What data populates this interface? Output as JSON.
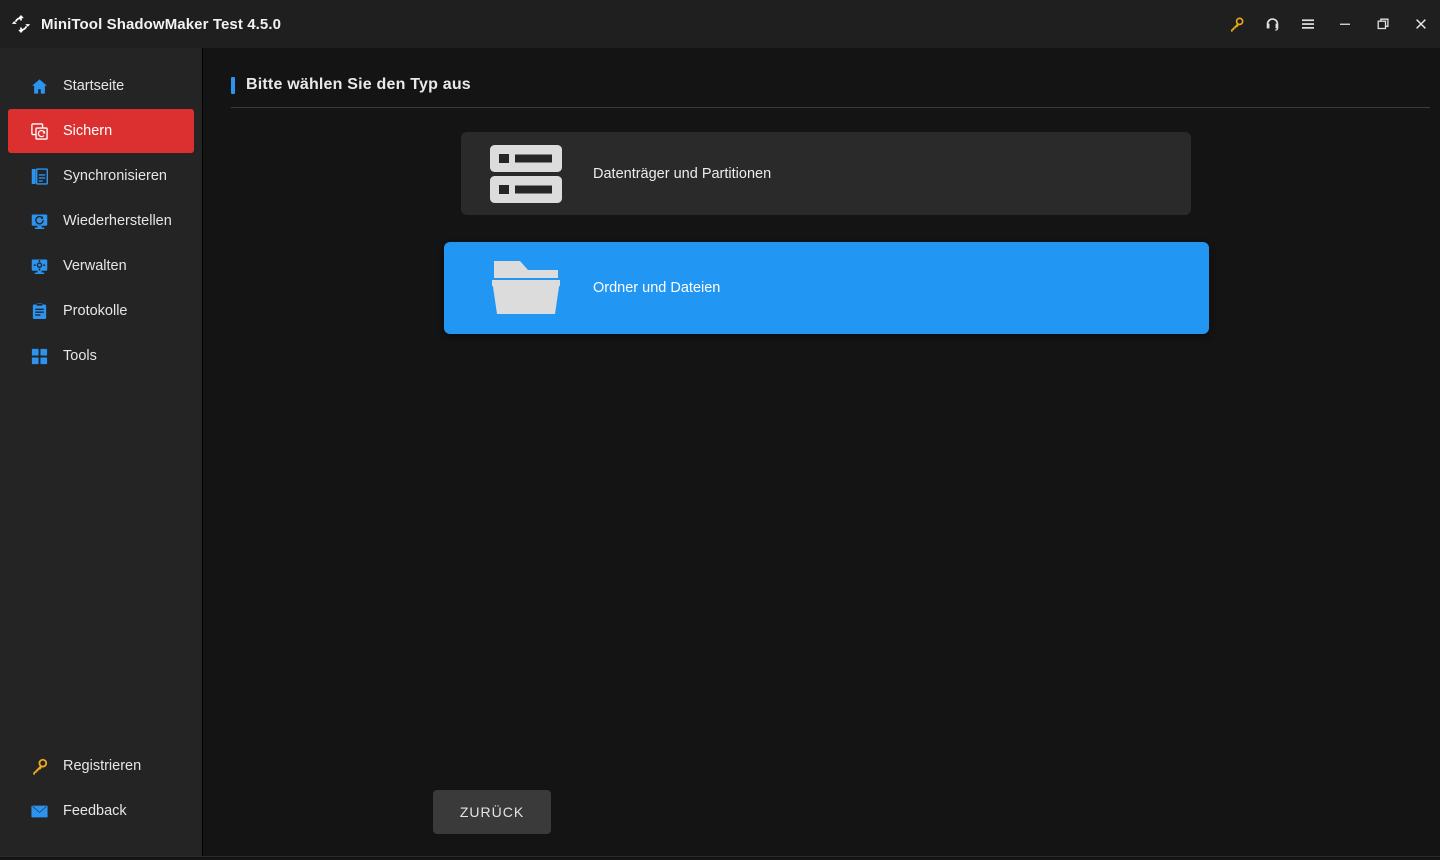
{
  "window": {
    "title": "MiniTool ShadowMaker Test 4.5.0",
    "logo_icon": "sync-arrows-logo",
    "colors": {
      "titlebar_bg": "#1f1f1f",
      "sidebar_bg": "#242424",
      "main_bg": "#141414",
      "accent_blue": "#2196f3",
      "active_red": "#dc3030",
      "key_gold": "#f0a91e",
      "card_bg": "#2a2a2a",
      "button_bg": "#3a3a3a"
    }
  },
  "titlebar_actions": [
    {
      "name": "register-key-icon",
      "icon": "key-icon",
      "tooltip": "Registrieren"
    },
    {
      "name": "support-headset-icon",
      "icon": "headset-icon",
      "tooltip": "Support"
    },
    {
      "name": "menu-icon",
      "icon": "hamburger-menu-icon",
      "tooltip": "Menü"
    },
    {
      "name": "minimize-button",
      "icon": "minimize-icon",
      "tooltip": "Minimieren"
    },
    {
      "name": "maximize-button",
      "icon": "restore-icon",
      "tooltip": "Maximieren"
    },
    {
      "name": "close-button",
      "icon": "close-icon",
      "tooltip": "Schließen"
    }
  ],
  "sidebar": {
    "items": [
      {
        "label": "Startseite",
        "icon": "home-icon",
        "active": false
      },
      {
        "label": "Sichern",
        "icon": "backup-icon",
        "active": true
      },
      {
        "label": "Synchronisieren",
        "icon": "sync-icon",
        "active": false
      },
      {
        "label": "Wiederherstellen",
        "icon": "restore-monitor-icon",
        "active": false
      },
      {
        "label": "Verwalten",
        "icon": "manage-gear-monitor-icon",
        "active": false
      },
      {
        "label": "Protokolle",
        "icon": "logs-clipboard-icon",
        "active": false
      },
      {
        "label": "Tools",
        "icon": "tools-grid-icon",
        "active": false
      }
    ],
    "bottom_items": [
      {
        "label": "Registrieren",
        "icon": "key-icon"
      },
      {
        "label": "Feedback",
        "icon": "mail-icon"
      }
    ]
  },
  "main": {
    "section_title": "Bitte wählen Sie den Typ aus",
    "options": [
      {
        "label": "Datenträger und Partitionen",
        "icon": "disks-partitions-icon",
        "selected": false
      },
      {
        "label": "Ordner und Dateien",
        "icon": "folder-icon",
        "selected": true
      }
    ],
    "back_button_label": "ZURÜCK"
  }
}
